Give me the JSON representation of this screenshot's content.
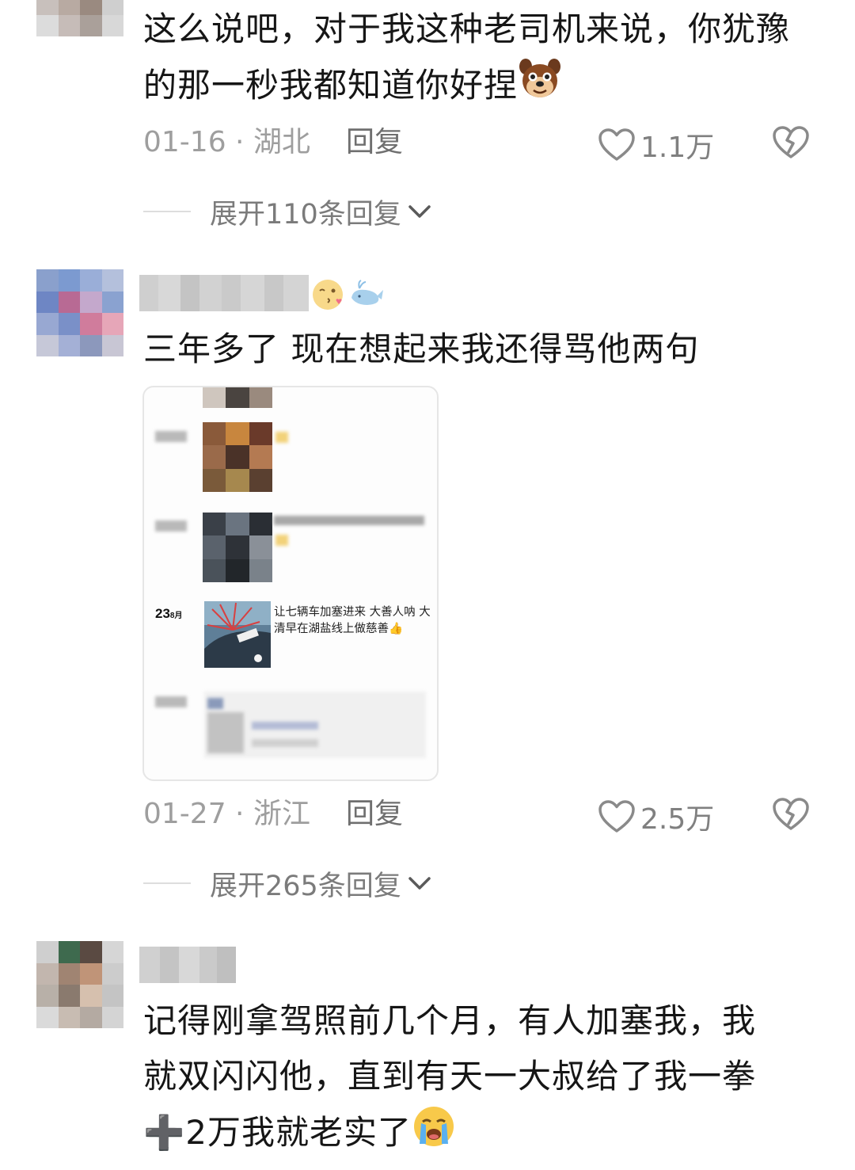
{
  "comments": [
    {
      "text_prefix": "这么说吧，对于我这种老司机来说，你犹豫的那一秒我都知道你好捏",
      "emoji": "dog-face-emoji",
      "date": "01-16 · 湖北",
      "reply_label": "回复",
      "likes": "1.1万",
      "expand_label": "展开110条回复"
    },
    {
      "text": "三年多了  现在想起来我还得骂他两句",
      "username_emojis": [
        "winking-kiss-emoji",
        "whale-emoji"
      ],
      "image": {
        "post_day": "23",
        "post_month": "8月",
        "post_caption": "让七辆车加塞进来  大善人呐  大清早在湖盐线上做慈善👍"
      },
      "date": "01-27 · 浙江",
      "reply_label": "回复",
      "likes": "2.5万",
      "expand_label": "展开265条回复"
    },
    {
      "text_line1": "记得刚拿驾照前几个月，有人加塞我，我",
      "text_line2": "就双闪闪他，直到有天一大叔给了我一拳",
      "text_line3_prefix": "➕",
      "text_line3": "2万我就老实了",
      "emoji": "crying-face-emoji"
    }
  ],
  "colors": {
    "text_primary": "#161616",
    "text_meta": "#9e9e9e",
    "icon_gray": "#808080"
  }
}
